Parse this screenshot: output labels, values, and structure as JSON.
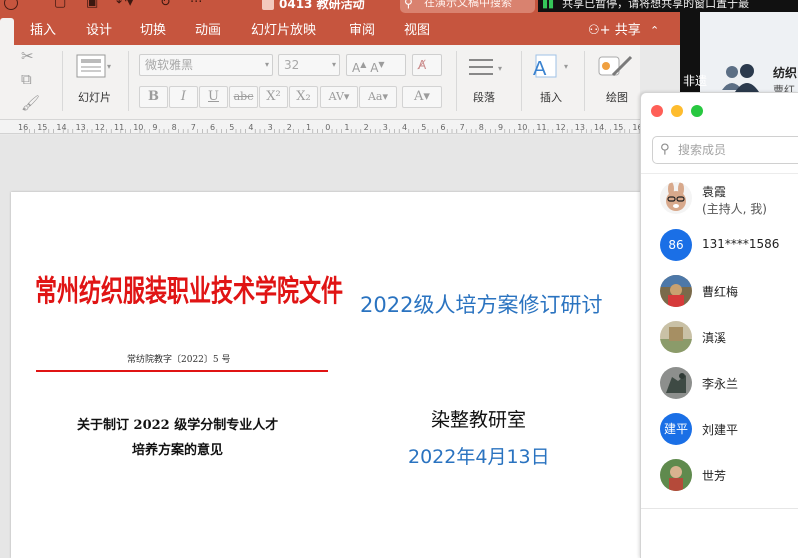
{
  "titlebar": {
    "document_title": "0413 教研活动",
    "search_placeholder": "在演示文稿中搜索",
    "share_banner": "共享已暂停，请将想共享的窗口置于最"
  },
  "ribbon_tabs": [
    "插入",
    "设计",
    "切换",
    "动画",
    "幻灯片放映",
    "审阅",
    "视图"
  ],
  "share_button": "共享",
  "toolbar": {
    "slides_label": "幻灯片",
    "font_name": "微软雅黑",
    "font_size": "32",
    "bold": "B",
    "italic": "I",
    "underline": "U",
    "strikethrough": "abc",
    "superscript": "X²",
    "subscript": "X₂",
    "paragraph_label": "段落",
    "insert_label": "插入",
    "drawing_label": "绘图"
  },
  "ruler": {
    "numbers": [
      16,
      15,
      14,
      13,
      12,
      11,
      10,
      9,
      8,
      7,
      6,
      5,
      4,
      3,
      2,
      1,
      0,
      1,
      2,
      3,
      4,
      5,
      6,
      7,
      8,
      9,
      10,
      11,
      12,
      13,
      14,
      15,
      16
    ]
  },
  "slide": {
    "org_title": "常州纺织服装职业技术学院文件",
    "doc_number": "常纺院教字〔2022〕5 号",
    "notice_line1": "关于制订 2022 级学分制专业人才",
    "notice_line2": "培养方案的意见",
    "seminar_title": "2022级人培方案修订研讨",
    "office": "染整教研室",
    "date": "2022年4月13日"
  },
  "background_app": {
    "text_left": "非遗",
    "text_title": "纺织",
    "text_sub": "曹红"
  },
  "members_panel": {
    "search_placeholder": "搜索成员",
    "members": [
      {
        "name": "袁霞",
        "role": "(主持人, 我)",
        "avatar": "rabbit-avatar"
      },
      {
        "name": "131****1586",
        "avatar_text": "86"
      },
      {
        "name": "曹红梅",
        "avatar": "photo-avatar"
      },
      {
        "name": "滇溪",
        "avatar": "photo-avatar"
      },
      {
        "name": "李永兰",
        "avatar": "photo-avatar"
      },
      {
        "name": "刘建平",
        "avatar_text": "建平"
      },
      {
        "name": "世芳",
        "avatar": "photo-avatar"
      }
    ]
  },
  "colors": {
    "ribbon": "#c6553e",
    "red_title": "#e01414",
    "blue_text": "#2a73c0",
    "avatar_blue": "#1a6fe6"
  }
}
